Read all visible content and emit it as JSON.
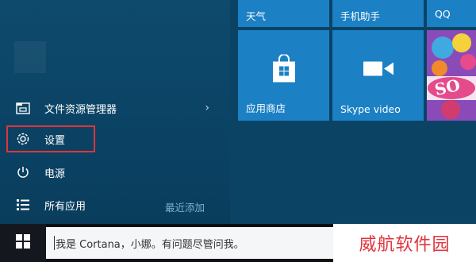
{
  "start_menu": {
    "left_items": [
      {
        "label": "文件资源管理器",
        "icon": "file-explorer-icon",
        "has_submenu": true
      },
      {
        "label": "设置",
        "icon": "gear-icon",
        "highlighted": true
      },
      {
        "label": "电源",
        "icon": "power-icon"
      },
      {
        "label": "所有应用",
        "icon": "all-apps-icon"
      }
    ],
    "recently_added_label": "最近添加",
    "highlight_color": "#e0343c"
  },
  "tiles": [
    {
      "label": "天气",
      "color": "#1b80c4"
    },
    {
      "label": "手机助手",
      "color": "#1b80c4"
    },
    {
      "label": "QQ",
      "color": "#1b80c4"
    },
    {
      "label": "应用商店",
      "icon": "store-icon",
      "color": "#1b80c4"
    },
    {
      "label": "Skype video",
      "icon": "video-camera-icon",
      "color": "#1b80c4"
    },
    {
      "label": "SO",
      "icon": "candy-crush-icon"
    }
  ],
  "taskbar": {
    "start_icon": "windows-logo-icon",
    "search_placeholder": "我是 Cortana，小娜。有问题尽管问我。"
  },
  "watermark": "威航软件园"
}
